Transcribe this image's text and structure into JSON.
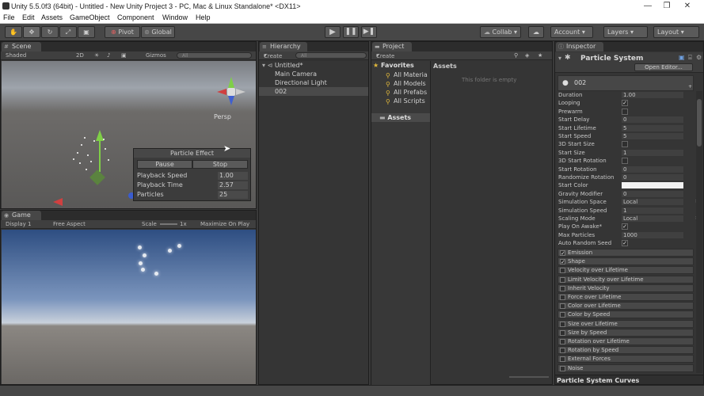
{
  "window": {
    "title": "Unity 5.5.0f3 (64bit) - Untitled - New Unity Project 3 - PC, Mac & Linux Standalone* <DX11>",
    "minimize": "—",
    "maximize": "❐",
    "close": "✕"
  },
  "menu": [
    "File",
    "Edit",
    "Assets",
    "GameObject",
    "Component",
    "Window",
    "Help"
  ],
  "toolbar": {
    "pivot": "Pivot",
    "global": "Global",
    "collab": "Collab",
    "account": "Account",
    "layers": "Layers",
    "layout": "Layout"
  },
  "scene": {
    "tab": "Scene",
    "shading": "Shaded",
    "mode2d": "2D",
    "gizmos": "Gizmos",
    "search": "All",
    "persp": "Persp",
    "particle_effect": {
      "title": "Particle Effect",
      "pause": "Pause",
      "stop": "Stop",
      "rows": [
        {
          "label": "Playback Speed",
          "value": "1.00"
        },
        {
          "label": "Playback Time",
          "value": "2.57"
        },
        {
          "label": "Particles",
          "value": "25"
        }
      ]
    }
  },
  "game": {
    "tab": "Game",
    "display": "Display 1",
    "aspect": "Free Aspect",
    "scale": "Scale",
    "scale_value": "1x",
    "maximize": "Maximize On Play"
  },
  "hierarchy": {
    "tab": "Hierarchy",
    "create": "Create",
    "search": "All",
    "scene_name": "Untitled*",
    "items": [
      "Main Camera",
      "Directional Light",
      "002"
    ]
  },
  "project": {
    "tab": "Project",
    "create": "Create",
    "favorites": "Favorites",
    "fav_items": [
      "All Materia",
      "All Models",
      "All Prefabs",
      "All Scripts"
    ],
    "assets_folder": "Assets",
    "assets_header": "Assets",
    "empty_text": "This folder is empty"
  },
  "inspector": {
    "tab": "Inspector",
    "component": "Particle System",
    "open_editor": "Open Editor...",
    "object_name": "002",
    "props": [
      {
        "label": "Duration",
        "value": "1.00"
      },
      {
        "label": "Looping",
        "value": "✓"
      },
      {
        "label": "Prewarm",
        "value": ""
      },
      {
        "label": "Start Delay",
        "value": "0"
      },
      {
        "label": "Start Lifetime",
        "value": "5"
      },
      {
        "label": "Start Speed",
        "value": "5"
      },
      {
        "label": "3D Start Size",
        "value": ""
      },
      {
        "label": "Start Size",
        "value": "1"
      },
      {
        "label": "3D Start Rotation",
        "value": ""
      },
      {
        "label": "Start Rotation",
        "value": "0"
      },
      {
        "label": "Randomize Rotation",
        "value": "0"
      },
      {
        "label": "Start Color",
        "value": ""
      },
      {
        "label": "Gravity Modifier",
        "value": "0"
      },
      {
        "label": "Simulation Space",
        "value": "Local"
      },
      {
        "label": "Simulation Speed",
        "value": "1"
      },
      {
        "label": "Scaling Mode",
        "value": "Local"
      },
      {
        "label": "Play On Awake*",
        "value": "✓"
      },
      {
        "label": "Max Particles",
        "value": "1000"
      },
      {
        "label": "Auto Random Seed",
        "value": "✓"
      }
    ],
    "modules": [
      {
        "label": "Emission",
        "checked": "✓"
      },
      {
        "label": "Shape",
        "checked": "✓"
      },
      {
        "label": "Velocity over Lifetime",
        "checked": ""
      },
      {
        "label": "Limit Velocity over Lifetime",
        "checked": ""
      },
      {
        "label": "Inherit Velocity",
        "checked": ""
      },
      {
        "label": "Force over Lifetime",
        "checked": ""
      },
      {
        "label": "Color over Lifetime",
        "checked": ""
      },
      {
        "label": "Color by Speed",
        "checked": ""
      },
      {
        "label": "Size over Lifetime",
        "checked": ""
      },
      {
        "label": "Size by Speed",
        "checked": ""
      },
      {
        "label": "Rotation over Lifetime",
        "checked": ""
      },
      {
        "label": "Rotation by Speed",
        "checked": ""
      },
      {
        "label": "External Forces",
        "checked": ""
      },
      {
        "label": "Noise",
        "checked": ""
      }
    ],
    "curves": "Particle System Curves"
  }
}
